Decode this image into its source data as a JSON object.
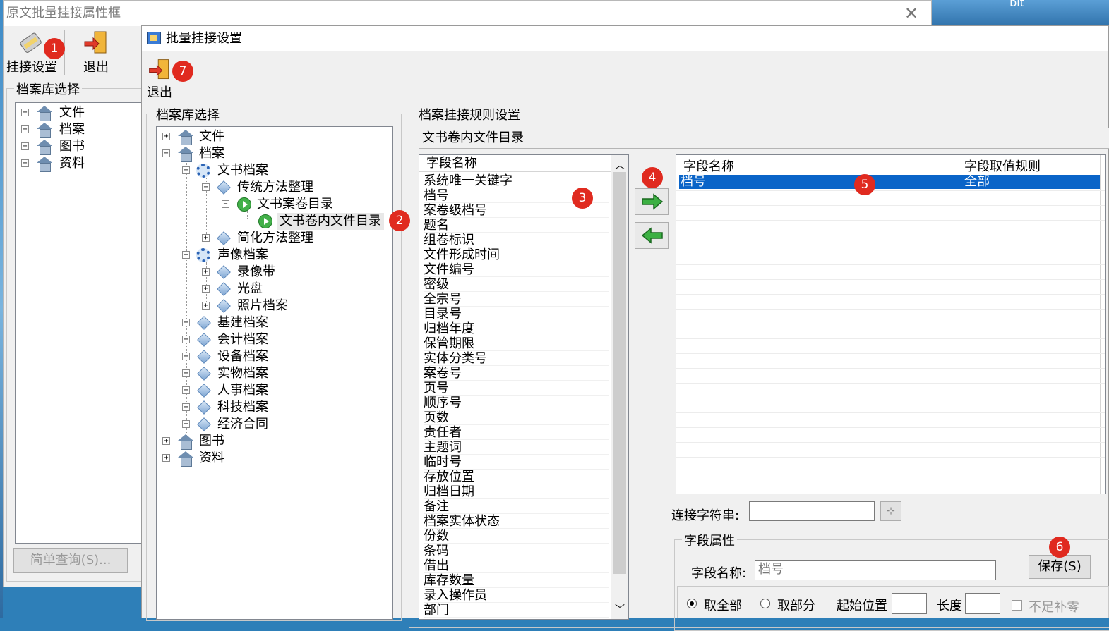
{
  "desktop": {
    "label": "bit"
  },
  "back_window": {
    "title": "原文批量挂接属性框",
    "toolbar": {
      "settings_label": "挂接设置",
      "exit_label": "退出"
    },
    "archive_group_title": "档案库选择",
    "tree": [
      "文件",
      "档案",
      "图书",
      "资料"
    ],
    "query_button": "简单查询(S)..."
  },
  "front_window": {
    "title": "批量挂接设置",
    "exit_label": "退出",
    "archive_group_title": "档案库选择",
    "tree": {
      "files": "文件",
      "archives": "档案",
      "doc_archives": "文书档案",
      "traditional": "传统方法整理",
      "case_catalog": "文书案卷目录",
      "file_catalog": "文书卷内文件目录",
      "simplified": "简化方法整理",
      "av_archives": "声像档案",
      "video_tape": "录像带",
      "disc": "光盘",
      "photo": "照片档案",
      "construction": "基建档案",
      "accounting": "会计档案",
      "equipment": "设备档案",
      "physical": "实物档案",
      "personnel": "人事档案",
      "tech": "科技档案",
      "contract": "经济合同",
      "books": "图书",
      "materials": "资料"
    },
    "rule_group_title": "档案挂接规则设置",
    "current_table": "文书卷内文件目录",
    "field_list_header": "字段名称",
    "fields": [
      "系统唯一关键字",
      "档号",
      "案卷级档号",
      "题名",
      "组卷标识",
      "文件形成时间",
      "文件编号",
      "密级",
      "全宗号",
      "目录号",
      "归档年度",
      "保管期限",
      "实体分类号",
      "案卷号",
      "页号",
      "顺序号",
      "页数",
      "责任者",
      "主题词",
      "临时号",
      "存放位置",
      "归档日期",
      "备注",
      "档案实体状态",
      "份数",
      "条码",
      "借出",
      "库存数量",
      "录入操作员",
      "部门"
    ],
    "grid": {
      "col_field": "字段名称",
      "col_rule": "字段取值规则",
      "rows": [
        {
          "field": "档号",
          "rule": "全部"
        }
      ]
    },
    "connect_label": "连接字符串:",
    "connect_value": "",
    "props_title": "字段属性",
    "field_name_label": "字段名称:",
    "field_name_value": "档号",
    "save_button": "保存(S)",
    "radio_all": "取全部",
    "radio_part": "取部分",
    "start_label": "起始位置",
    "length_label": "长度",
    "pad_zero_label": "不足补零"
  },
  "badges": [
    "1",
    "2",
    "3",
    "4",
    "5",
    "6",
    "7"
  ],
  "colors": {
    "selection": "#0a64c8",
    "badge": "#e02a1f",
    "arrow_green": "#3cb043"
  }
}
